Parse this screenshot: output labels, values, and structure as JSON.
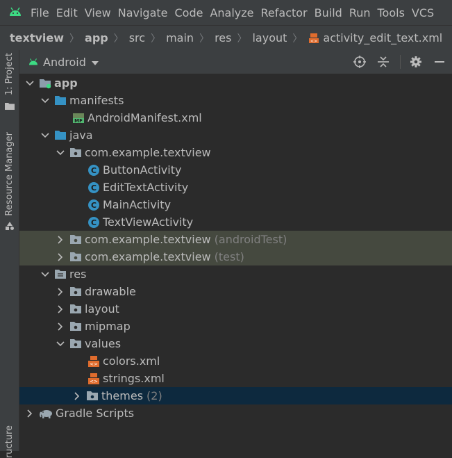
{
  "menu": [
    "File",
    "Edit",
    "View",
    "Navigate",
    "Code",
    "Analyze",
    "Refactor",
    "Build",
    "Run",
    "Tools",
    "VCS"
  ],
  "breadcrumb": [
    "textview",
    "app",
    "src",
    "main",
    "res",
    "layout",
    "activity_edit_text.xml"
  ],
  "left_tabs": {
    "project": "1: Project",
    "resource_manager": "Resource Manager",
    "structure": "ructure"
  },
  "panel": {
    "view_selector": "Android"
  },
  "tree": {
    "app": "app",
    "manifests": "manifests",
    "manifest_file": "AndroidManifest.xml",
    "java": "java",
    "pkg_main": "com.example.textview",
    "classes": [
      "ButtonActivity",
      "EditTextActivity",
      "MainActivity",
      "TextViewActivity"
    ],
    "pkg_android_test": "com.example.textview",
    "pkg_android_test_suffix": "(androidTest)",
    "pkg_test": "com.example.textview",
    "pkg_test_suffix": "(test)",
    "res": "res",
    "drawable": "drawable",
    "layout": "layout",
    "mipmap": "mipmap",
    "values": "values",
    "colors": "colors.xml",
    "strings": "strings.xml",
    "themes": "themes",
    "themes_count": "(2)",
    "gradle": "Gradle Scripts"
  },
  "colors": {
    "accent_android": "#3ddc84",
    "folder": "#3592c4",
    "class_icon": "#3592c4",
    "xml_icon": "#e06c2d",
    "selection": "#0d293e",
    "highlight": "#45493f"
  }
}
